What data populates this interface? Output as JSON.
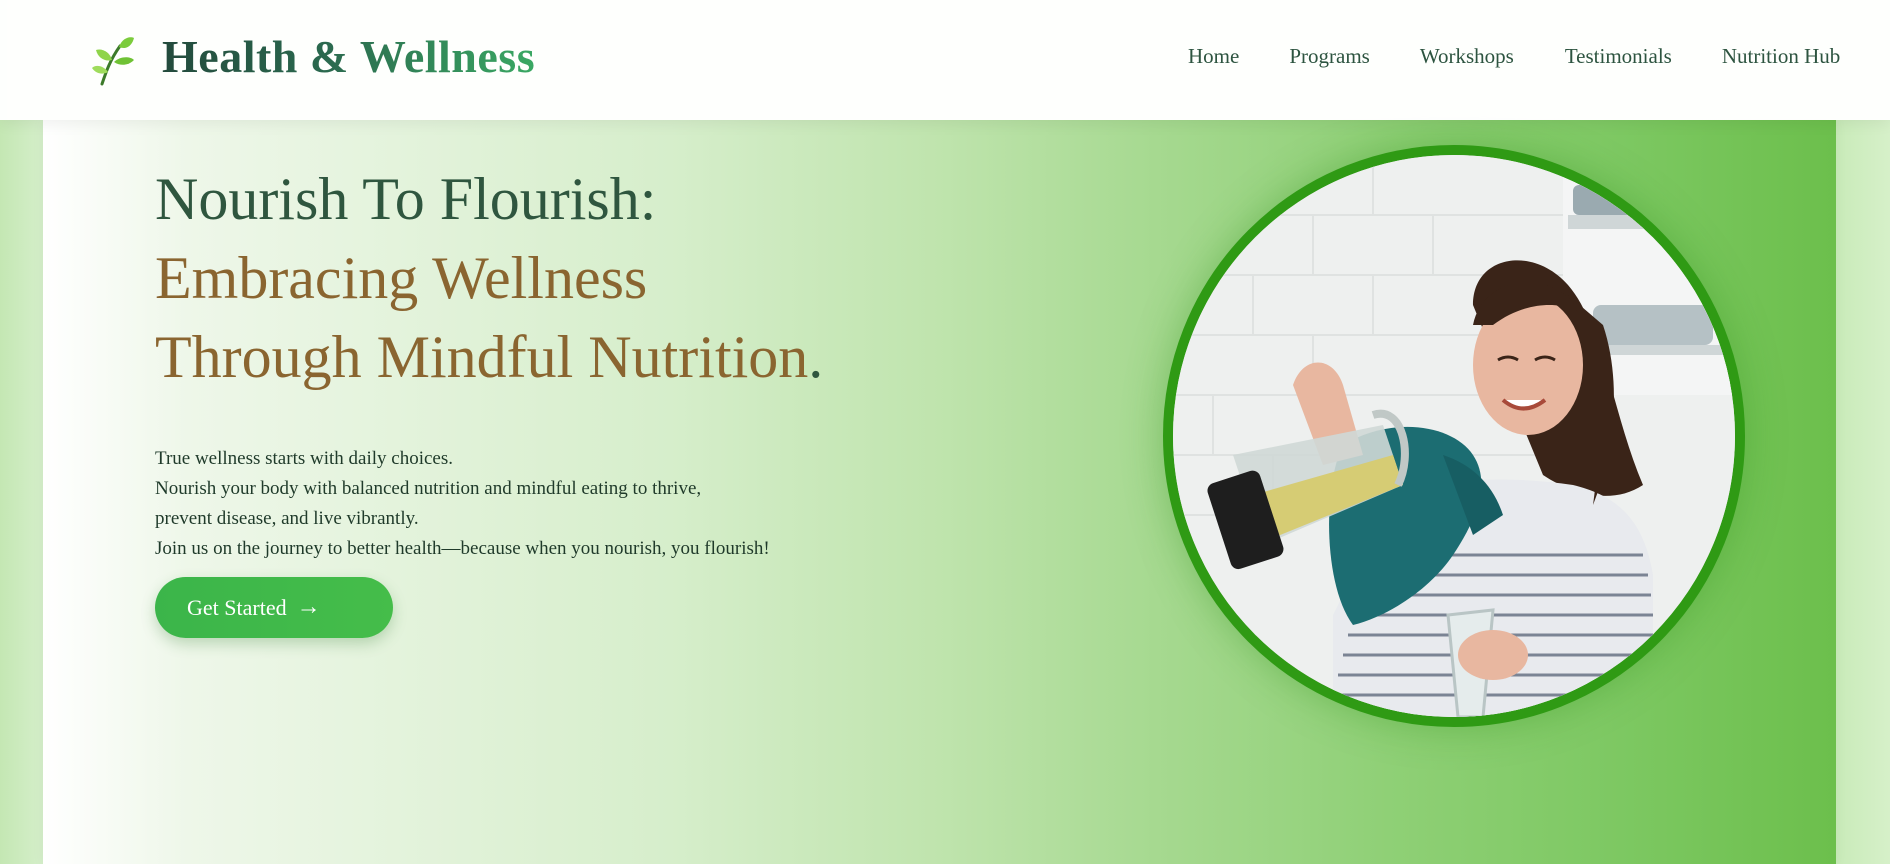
{
  "header": {
    "brand": "Health & Wellness",
    "logo_icon": "leaf-icon",
    "nav": [
      "Home",
      "Programs",
      "Workshops",
      "Testimonials",
      "Nutrition Hub"
    ]
  },
  "hero": {
    "headline_line1": "Nourish To Flourish:",
    "headline_line2": "Embracing Wellness",
    "headline_line3": "Through Mindful Nutrition",
    "headline_end": ".",
    "body": [
      "True wellness starts with daily choices.",
      "Nourish your body with balanced nutrition and mindful eating to thrive,",
      "prevent disease, and live vibrantly.",
      "Join us on the journey to better health—because when you nourish, you flourish!"
    ],
    "cta_label": "Get Started",
    "cta_arrow": "→",
    "image_alt": "woman pouring smoothie from blender"
  },
  "colors": {
    "brand_dark": "#234a3c",
    "brand_green": "#3aa863",
    "headline_green": "#2f563f",
    "headline_brown": "#8a6530",
    "cta": "#3bb54a",
    "ring": "#2f9a14"
  }
}
